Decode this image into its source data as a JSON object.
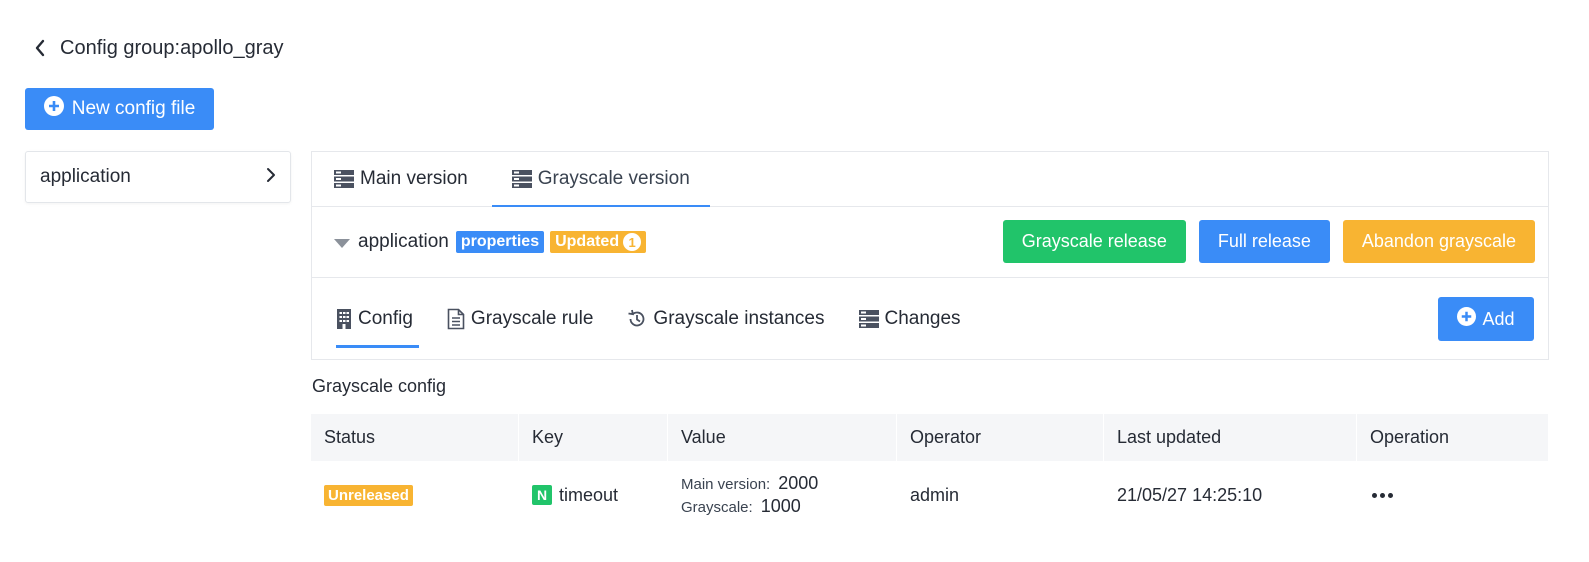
{
  "header": {
    "title": "Config group:apollo_gray",
    "back_icon": "chevron-left-icon"
  },
  "toolbar": {
    "new_file_label": "New config file",
    "new_file_icon": "plus-circle-icon"
  },
  "sidebar": {
    "items": [
      {
        "label": "application",
        "icon": "chevron-right-icon"
      }
    ]
  },
  "version_tabs": [
    {
      "label": "Main version",
      "icon": "server-icon",
      "active": false
    },
    {
      "label": "Grayscale version",
      "icon": "server-icon",
      "active": true
    }
  ],
  "namespace": {
    "name": "application",
    "format_tag": "properties",
    "updated_tag": "Updated",
    "updated_count": "1",
    "actions": {
      "grayscale_release": "Grayscale release",
      "full_release": "Full release",
      "abandon_grayscale": "Abandon grayscale"
    }
  },
  "sub_tabs": [
    {
      "label": "Config",
      "icon": "building-icon",
      "active": true
    },
    {
      "label": "Grayscale rule",
      "icon": "document-icon",
      "active": false
    },
    {
      "label": "Grayscale instances",
      "icon": "history-icon",
      "active": false
    },
    {
      "label": "Changes",
      "icon": "server-icon",
      "active": false
    }
  ],
  "add_label": "Add",
  "section_title": "Grayscale config",
  "table": {
    "columns": [
      "Status",
      "Key",
      "Value",
      "Operator",
      "Last updated",
      "Operation"
    ],
    "rows": [
      {
        "status": "Unreleased",
        "key_badge": "N",
        "key": "timeout",
        "main_label": "Main version:",
        "main_value": "2000",
        "gray_label": "Grayscale:",
        "gray_value": "1000",
        "operator": "admin",
        "last_updated": "21/05/27 14:25:10",
        "operation_icon": "more-icon"
      }
    ]
  },
  "colors": {
    "primary": "#3a8cf7",
    "success": "#21c46a",
    "warning": "#f8b432",
    "text": "#262b35"
  }
}
